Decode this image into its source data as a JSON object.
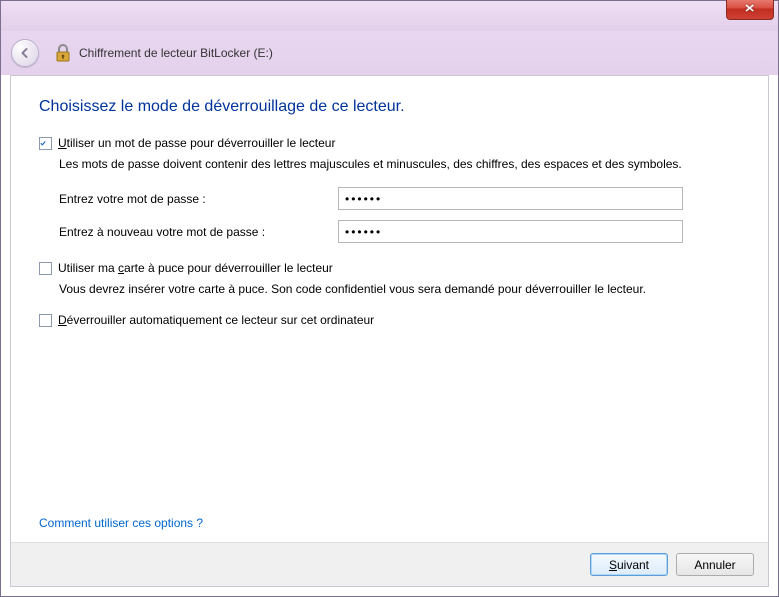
{
  "window": {
    "close_label": "✕"
  },
  "nav": {
    "title": "Chiffrement de lecteur BitLocker (E:)"
  },
  "main": {
    "heading": "Choisissez le mode de déverrouillage de ce lecteur.",
    "password_option": {
      "checked": true,
      "label_underline": "U",
      "label_rest": "tiliser un mot de passe pour déverrouiller le lecteur",
      "description": "Les mots de passe doivent contenir des lettres majuscules et minuscules, des chiffres, des espaces et des symboles.",
      "field1_label": "Entrez votre mot de passe :",
      "field1_value": "••••••",
      "field2_label": "Entrez à nouveau votre mot de passe :",
      "field2_value": "••••••"
    },
    "smartcard_option": {
      "checked": false,
      "label_pre": "Utiliser ma ",
      "label_underline": "c",
      "label_post": "arte à puce pour déverrouiller le lecteur",
      "description": "Vous devrez insérer votre carte à puce. Son code confidentiel vous sera demandé pour déverrouiller le lecteur."
    },
    "auto_option": {
      "checked": false,
      "label_underline": "D",
      "label_rest": "éverrouiller automatiquement ce lecteur sur cet ordinateur"
    },
    "help_link": "Comment utiliser ces options ?"
  },
  "footer": {
    "next_underline": "S",
    "next_rest": "uivant",
    "cancel": "Annuler"
  }
}
